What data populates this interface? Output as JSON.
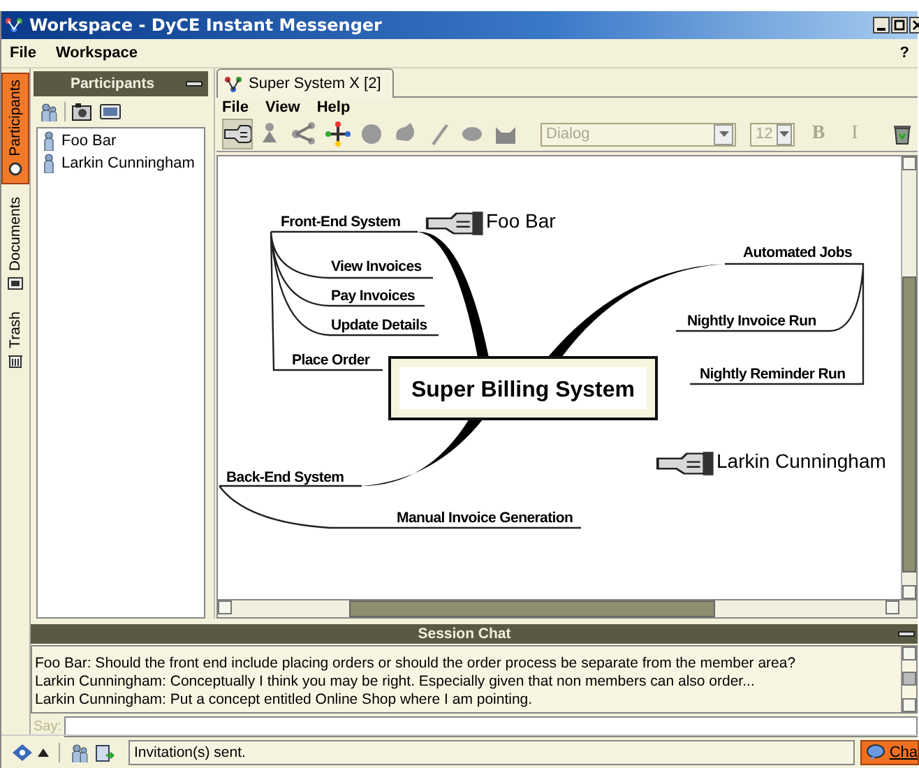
{
  "window": {
    "title": "Workspace - DyCE Instant Messenger"
  },
  "menu": [
    "File",
    "Workspace"
  ],
  "help": "?",
  "side_tabs": [
    {
      "label": "Participants",
      "selected": true
    },
    {
      "label": "Documents",
      "selected": false
    },
    {
      "label": "Trash",
      "selected": false
    }
  ],
  "participants": {
    "title": "Participants",
    "items": [
      "Foo Bar",
      "Larkin Cunningham"
    ]
  },
  "document_tabs": [
    {
      "label": "Super System X [2]",
      "selected": true
    }
  ],
  "document_menu": [
    "File",
    "View",
    "Help"
  ],
  "toolbar": {
    "tools": [
      {
        "kind": "pointer",
        "selected": true
      },
      {
        "kind": "figure",
        "selected": false
      },
      {
        "kind": "branch",
        "selected": false
      },
      {
        "kind": "tree",
        "selected": false
      },
      {
        "kind": "ball",
        "selected": false
      },
      {
        "kind": "blob",
        "selected": false
      },
      {
        "kind": "pen",
        "selected": false
      },
      {
        "kind": "leaf",
        "selected": false
      },
      {
        "kind": "cat",
        "selected": false
      }
    ],
    "font_field": {
      "value": "Dialog",
      "disabled": true
    },
    "size_field": {
      "value": "12",
      "disabled": true
    },
    "format_buttons": [
      {
        "label": "B",
        "disabled": true
      },
      {
        "label": "I",
        "disabled": true
      }
    ]
  },
  "mind_map": {
    "central": "Super Billing System",
    "branches": [
      {
        "label": "Front-End System",
        "children": [
          "View Invoices",
          "Pay Invoices",
          "Update Details",
          "Place Order"
        ]
      },
      {
        "label": "Automated Jobs",
        "children": [
          "Nightly Invoice Run",
          "Nightly Reminder Run"
        ]
      },
      {
        "label": "Back-End System",
        "children": [
          "Manual Invoice Generation"
        ]
      }
    ],
    "pointers": [
      {
        "user": "Foo Bar"
      },
      {
        "user": "Larkin Cunningham"
      }
    ]
  },
  "chat": {
    "title": "Session Chat",
    "messages": [
      "Foo Bar: Should the front end include placing orders or should the order process be separate from the member area?",
      "Larkin Cunningham: Conceptually I think you may be right. Especially given that non members can also order...",
      "Larkin Cunningham: Put a concept entitled Online Shop where I am pointing."
    ],
    "say_label": "Say:"
  },
  "status_bar": {
    "message": "Invitation(s) sent.",
    "chat_button": "Cha"
  }
}
